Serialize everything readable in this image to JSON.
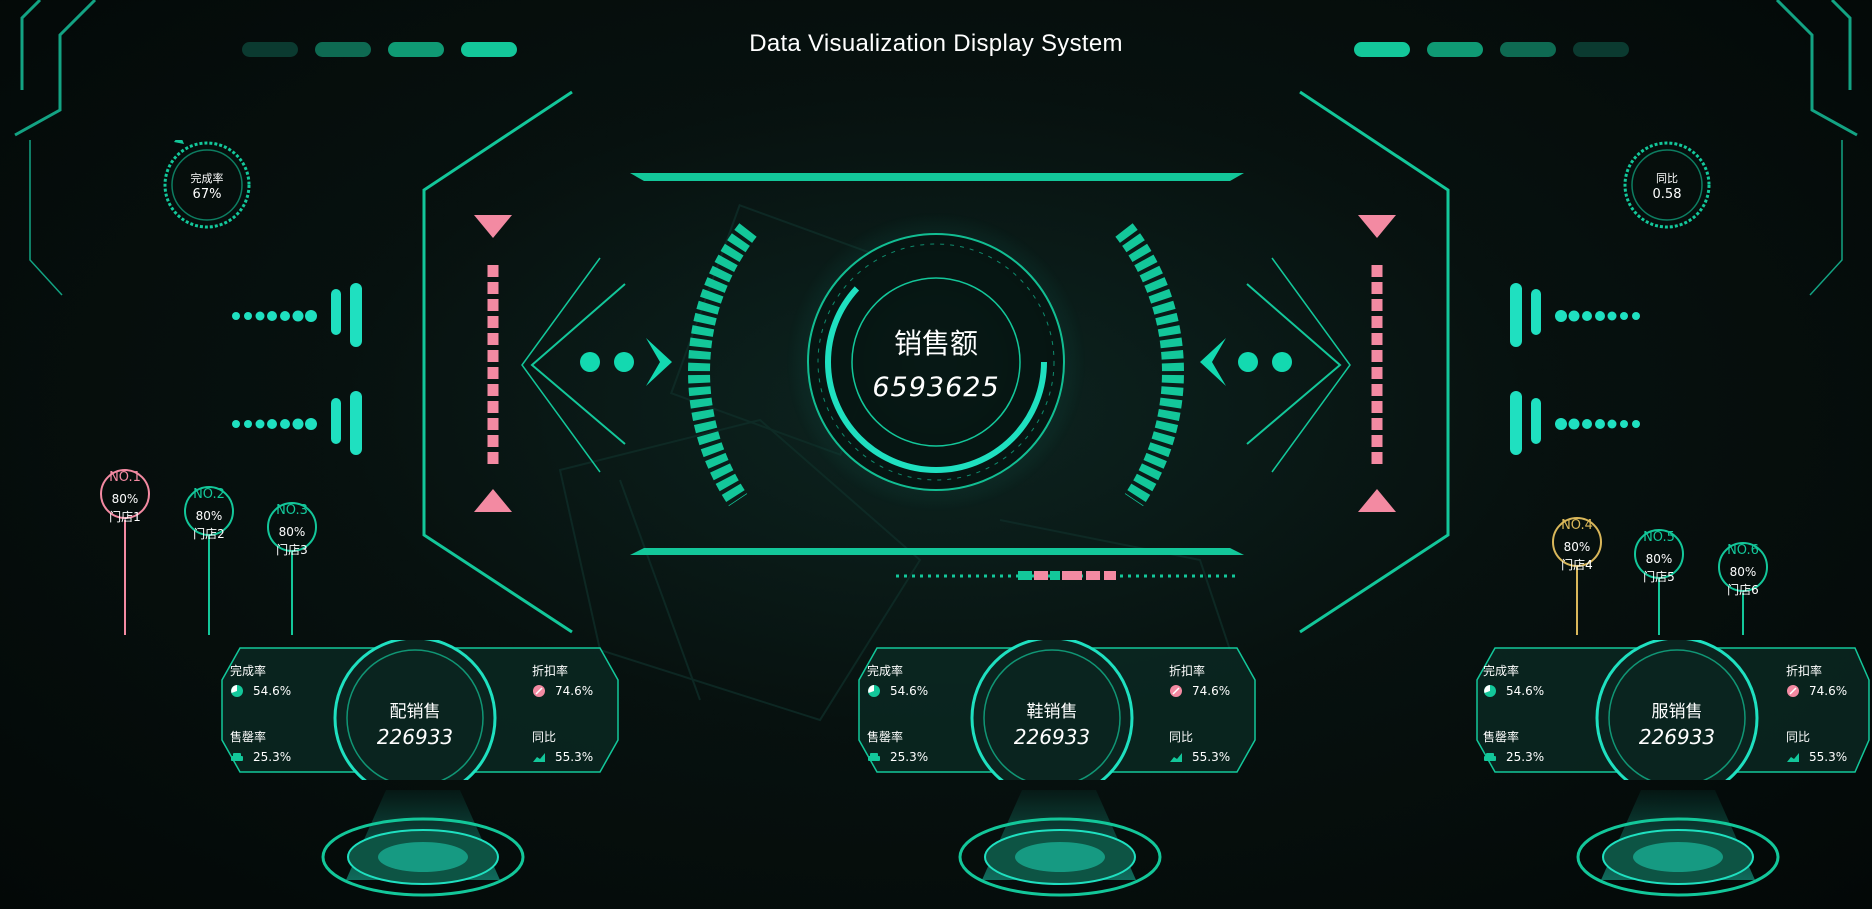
{
  "header": {
    "title": "Data Visualization Display System"
  },
  "theme": {
    "accent": "#13c79a",
    "accent_bright": "#1fe0c0",
    "alert_pink": "#f38aa2",
    "gold": "#d9b75a"
  },
  "gauges": {
    "left": {
      "label": "完成率",
      "value": "67%"
    },
    "right": {
      "label": "同比",
      "value": "0.58"
    }
  },
  "center": {
    "label": "销售额",
    "value": "6593625"
  },
  "stores": [
    {
      "no": "NO.1",
      "pct": "80%",
      "name": "门店1",
      "color": "#f38aa2"
    },
    {
      "no": "NO.2",
      "pct": "80%",
      "name": "门店2",
      "color": "#13c79a"
    },
    {
      "no": "NO.3",
      "pct": "80%",
      "name": "门店3",
      "color": "#13c79a"
    },
    {
      "no": "NO.4",
      "pct": "80%",
      "name": "门店4",
      "color": "#d9b75a"
    },
    {
      "no": "NO.5",
      "pct": "80%",
      "name": "门店5",
      "color": "#13c79a"
    },
    {
      "no": "NO.6",
      "pct": "80%",
      "name": "门店6",
      "color": "#13c79a"
    }
  ],
  "panels": [
    {
      "title": "配销售",
      "value": "226933",
      "completion_label": "完成率",
      "completion_value": "54.6%",
      "discount_label": "折扣率",
      "discount_value": "74.6%",
      "sales_label": "售罄率",
      "sales_value": "25.3%",
      "yoy_label": "同比",
      "yoy_value": "55.3%"
    },
    {
      "title": "鞋销售",
      "value": "226933",
      "completion_label": "完成率",
      "completion_value": "54.6%",
      "discount_label": "折扣率",
      "discount_value": "74.6%",
      "sales_label": "售罄率",
      "sales_value": "25.3%",
      "yoy_label": "同比",
      "yoy_value": "55.3%"
    },
    {
      "title": "服销售",
      "value": "226933",
      "completion_label": "完成率",
      "completion_value": "54.6%",
      "discount_label": "折扣率",
      "discount_value": "74.6%",
      "sales_label": "售罄率",
      "sales_value": "25.3%",
      "yoy_label": "同比",
      "yoy_value": "55.3%"
    }
  ],
  "icons": {
    "completion": "pie-icon",
    "discount": "discount-icon",
    "sales": "car-icon",
    "yoy": "trend-icon"
  }
}
